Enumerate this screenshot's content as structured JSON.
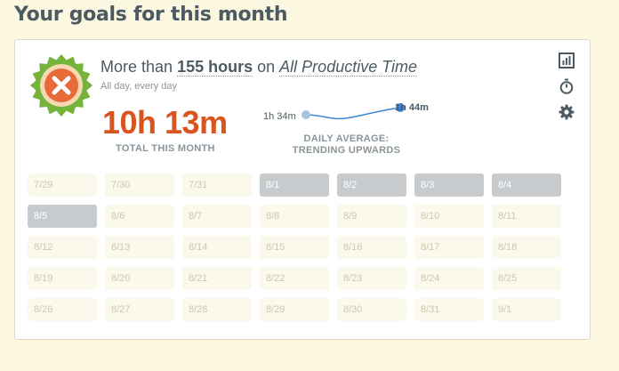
{
  "page": {
    "heading": "Your goals for this month"
  },
  "goal": {
    "prefix": "More than",
    "hours": "155 hours",
    "middle": "on",
    "category": "All Productive Time",
    "schedule": "All day, every day",
    "status_icon": "x-mark-badge-icon"
  },
  "summary": {
    "total": "10h 13m",
    "total_label": "TOTAL THIS MONTH",
    "spark_start": "1h 34m",
    "spark_end": "1h 44m",
    "avg_label_line1": "DAILY AVERAGE:",
    "avg_label_line2": "TRENDING UPWARDS"
  },
  "tools": [
    "bar-chart-icon",
    "stopwatch-icon",
    "gear-icon"
  ],
  "colors": {
    "accent": "#d9541e",
    "badge_ring": "#74b43a",
    "spark": "#3f86d8"
  },
  "calendar": [
    {
      "label": "7/29",
      "active": false
    },
    {
      "label": "7/30",
      "active": false
    },
    {
      "label": "7/31",
      "active": false
    },
    {
      "label": "8/1",
      "active": true
    },
    {
      "label": "8/2",
      "active": true
    },
    {
      "label": "8/3",
      "active": true
    },
    {
      "label": "8/4",
      "active": true
    },
    {
      "label": "8/5",
      "active": true
    },
    {
      "label": "8/6",
      "active": false
    },
    {
      "label": "8/7",
      "active": false
    },
    {
      "label": "8/8",
      "active": false
    },
    {
      "label": "8/9",
      "active": false
    },
    {
      "label": "8/10",
      "active": false
    },
    {
      "label": "8/11",
      "active": false
    },
    {
      "label": "8/12",
      "active": false
    },
    {
      "label": "8/13",
      "active": false
    },
    {
      "label": "8/14",
      "active": false
    },
    {
      "label": "8/15",
      "active": false
    },
    {
      "label": "8/16",
      "active": false
    },
    {
      "label": "8/17",
      "active": false
    },
    {
      "label": "8/18",
      "active": false
    },
    {
      "label": "8/19",
      "active": false
    },
    {
      "label": "8/20",
      "active": false
    },
    {
      "label": "8/21",
      "active": false
    },
    {
      "label": "8/22",
      "active": false
    },
    {
      "label": "8/23",
      "active": false
    },
    {
      "label": "8/24",
      "active": false
    },
    {
      "label": "8/25",
      "active": false
    },
    {
      "label": "8/26",
      "active": false
    },
    {
      "label": "8/27",
      "active": false
    },
    {
      "label": "8/28",
      "active": false
    },
    {
      "label": "8/29",
      "active": false
    },
    {
      "label": "8/30",
      "active": false
    },
    {
      "label": "8/31",
      "active": false
    },
    {
      "label": "9/1",
      "active": false
    }
  ]
}
